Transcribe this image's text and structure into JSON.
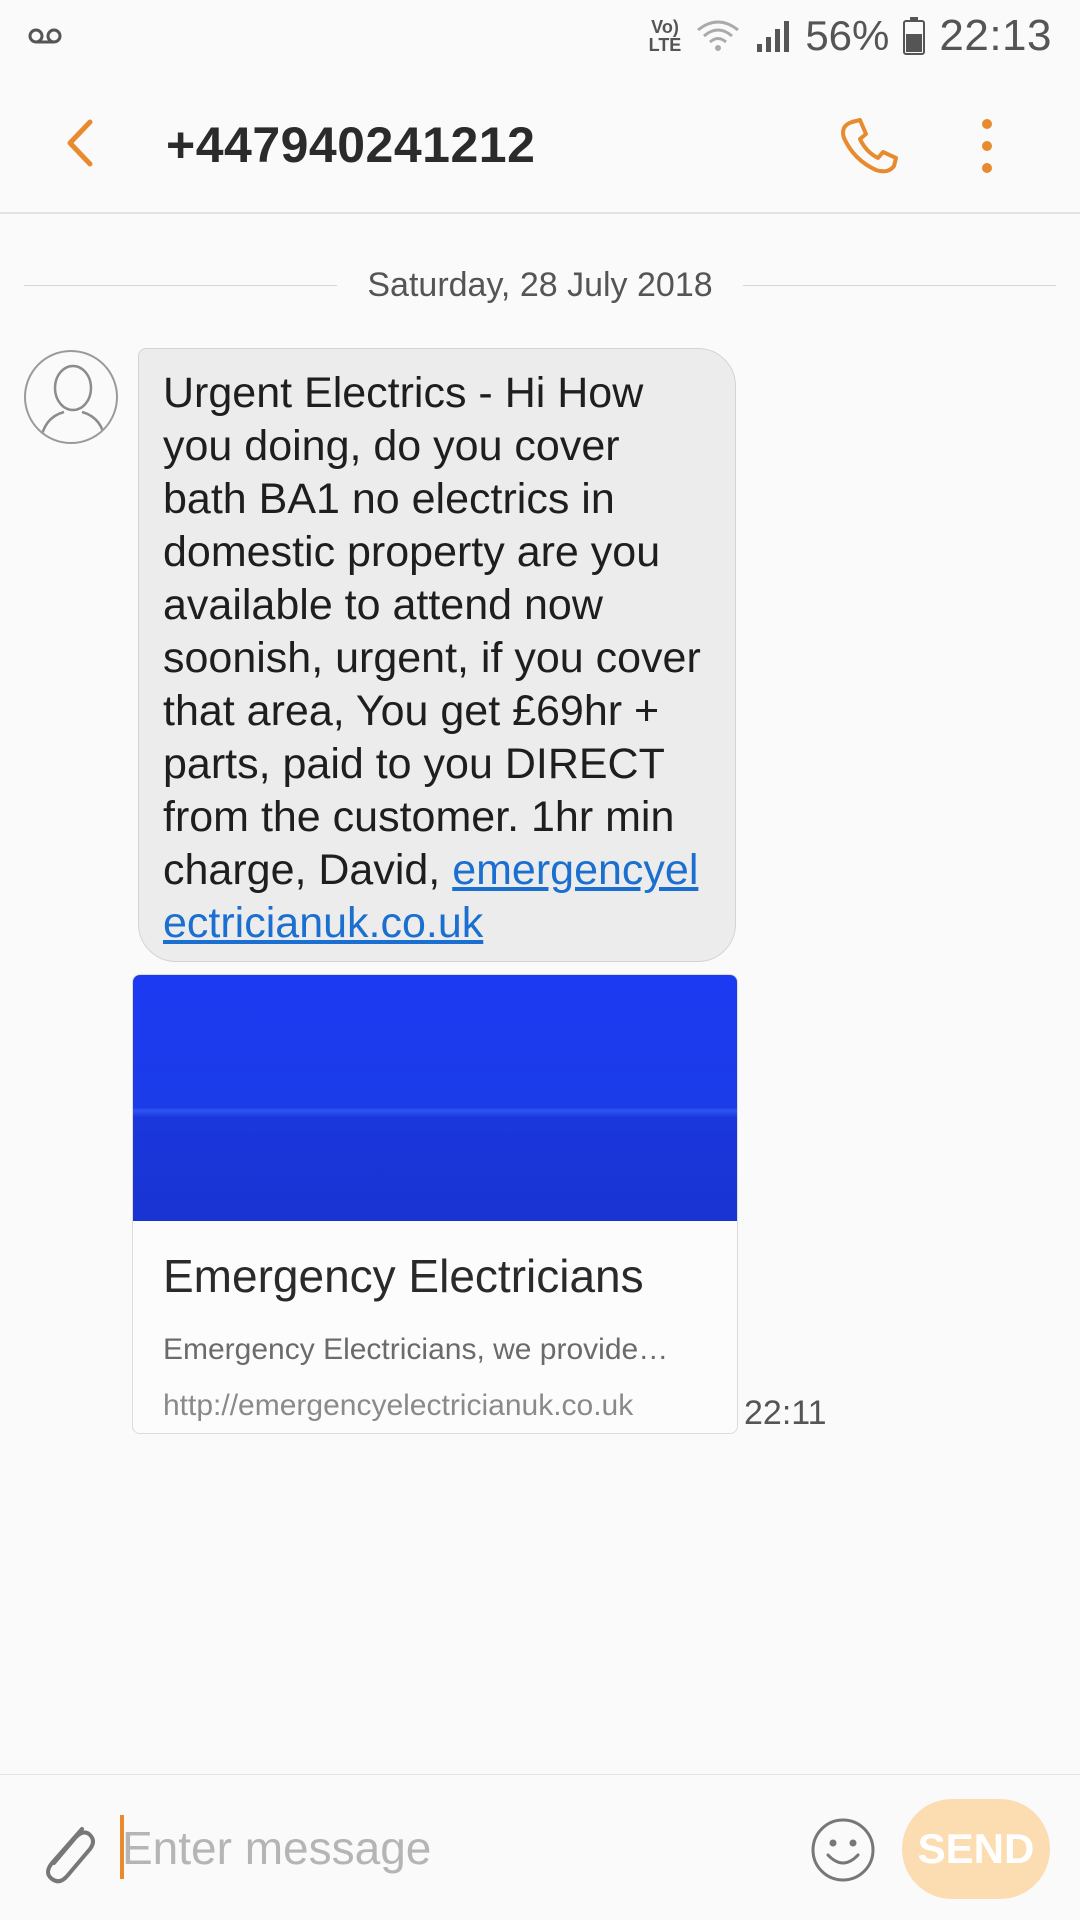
{
  "status_bar": {
    "voicemail_icon": "voicemail-icon",
    "volte_top": "Vo)",
    "volte_bottom": "LTE",
    "battery": "56%",
    "time": "22:13"
  },
  "header": {
    "title": "+447940241212",
    "accent_color": "#e88a2e"
  },
  "conversation": {
    "date": "Saturday, 28 July 2018",
    "message": {
      "text": "Urgent Electrics - Hi How you doing, do you cover bath BA1 no electrics in domestic property are you available to attend now soonish, urgent, if you cover that area, You get £69hr + parts, paid to you DIRECT from the customer. 1hr min charge, David, ",
      "link": "emergencyelectricianuk.co.uk",
      "time": "22:11"
    },
    "preview": {
      "title": "Emergency Electricians",
      "description": "Emergency Electricians, we provide…",
      "url": "http://emergencyelectricianuk.co.uk"
    }
  },
  "composer": {
    "placeholder": "Enter message",
    "send_label": "SEND"
  }
}
